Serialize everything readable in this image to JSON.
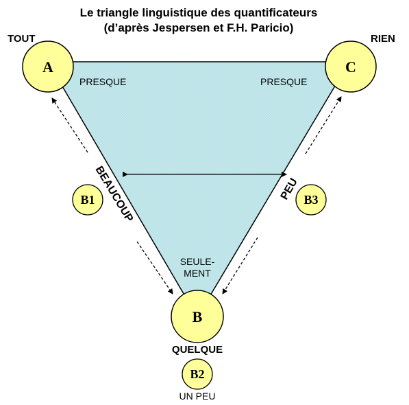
{
  "title": {
    "line1": "Le triangle linguistique des quantificateurs",
    "line2": "(d’après Jespersen et F.H. Paricio)"
  },
  "corners": {
    "tout": "TOUT",
    "rien": "RIEN",
    "quelque": "QUELQUE"
  },
  "nodes": {
    "a": "A",
    "b": "B",
    "c": "C",
    "b1": "B1",
    "b2": "B2",
    "b3": "B3"
  },
  "labels": {
    "presque_left": "PRESQUE",
    "presque_right": "PRESQUE",
    "seulement_line1": "SEULE-",
    "seulement_line2": "MENT",
    "beaucoup": "BEAUCOUP",
    "peu": "PEU",
    "un_peu": "UN PEU"
  },
  "colors": {
    "triangle_fill": "#bfe6ea",
    "node_fill": "#ffff99",
    "stroke": "#000000"
  }
}
